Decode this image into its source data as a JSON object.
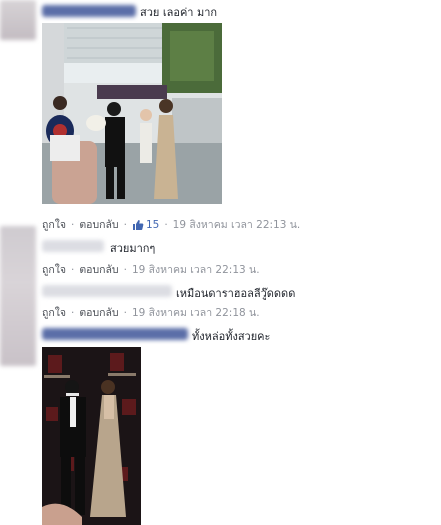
{
  "comments": [
    {
      "text": "สวย เลอค่า มาก",
      "has_photo": true
    },
    {
      "text": "สวยมากๆ",
      "has_photo": false
    },
    {
      "text": "เหมือนดาราฮอลลีวู๊ดดดด",
      "has_photo": false
    },
    {
      "text": "ทั้งหล่อทั้งสวยคะ",
      "has_photo": true
    }
  ],
  "meta": [
    {
      "like": "ถูกใจ",
      "reply": "ตอบกลับ",
      "likes": "15",
      "time": "19 สิงหาคม เวลา 22:13 น."
    },
    {
      "like": "ถูกใจ",
      "reply": "ตอบกลับ",
      "time": "19 สิงหาคม เวลา 22:13 น."
    },
    {
      "like": "ถูกใจ",
      "reply": "ตอบกลับ",
      "time": "19 สิงหาคม เวลา 22:18 น."
    }
  ],
  "colors": {
    "link": "#4267b2",
    "meta": "#90949c",
    "text": "#1d2129",
    "divider": "#e9ebee"
  }
}
